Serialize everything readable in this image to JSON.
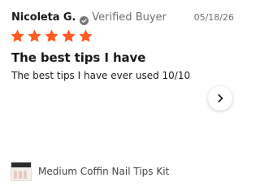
{
  "review": {
    "reviewer_name": "Nicoleta G.",
    "verified_label": "Verified Buyer",
    "date": "05/18/26",
    "rating": 5,
    "rating_max": 5,
    "title": "The best tips I have",
    "body": "The best tips I have ever used 10/10"
  },
  "product": {
    "name": "Medium Coffin Nail Tips Kit"
  },
  "colors": {
    "star": "#ff5a1f",
    "verified_icon": "#777777",
    "text_muted": "#6f6f6f"
  },
  "icons": {
    "verified": "check-badge-icon",
    "next": "chevron-right-icon",
    "star": "star-icon"
  }
}
